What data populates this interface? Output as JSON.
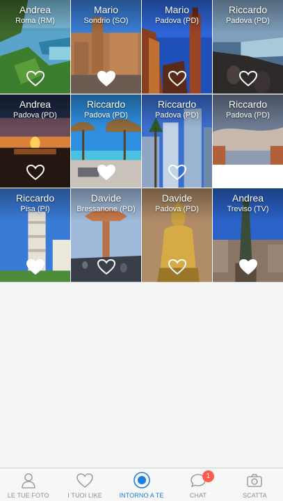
{
  "photos": [
    {
      "user": "Andrea",
      "place": "Roma (RM)",
      "liked": false
    },
    {
      "user": "Mario",
      "place": "Sondrio (SO)",
      "liked": false
    },
    {
      "user": "Mario",
      "place": "Padova (PD)",
      "liked": false
    },
    {
      "user": "Riccardo",
      "place": "Padova (PD)",
      "liked": false
    },
    {
      "user": "Andrea",
      "place": "Padova (PD)",
      "liked": false
    },
    {
      "user": "Riccardo",
      "place": "Padova (PD)",
      "liked": false
    },
    {
      "user": "Riccardo",
      "place": "Padova (PD)",
      "liked": false
    },
    {
      "user": "Riccardo",
      "place": "Padova (PD)",
      "liked": false
    },
    {
      "user": "Riccardo",
      "place": "Pisa (PI)",
      "liked": false
    },
    {
      "user": "Davide",
      "place": "Bressanone (PD)",
      "liked": false
    },
    {
      "user": "Davide",
      "place": "Padova (PD)",
      "liked": false
    },
    {
      "user": "Andrea",
      "place": "Treviso (TV)",
      "liked": false
    }
  ],
  "tabbar": {
    "tabs": [
      {
        "label": "LE TUE FOTO",
        "icon": "person-icon",
        "active": false
      },
      {
        "label": "I TUOI LIKE",
        "icon": "heart-icon",
        "active": false
      },
      {
        "label": "INTORNO A TE",
        "icon": "location-icon",
        "active": true
      },
      {
        "label": "CHAT",
        "icon": "chat-icon",
        "active": false,
        "badge": "1"
      },
      {
        "label": "SCATTA",
        "icon": "camera-icon",
        "active": false
      }
    ]
  },
  "colors": {
    "active": "#1a7de6",
    "inactive": "#8e8e93",
    "badge": "#ff5a4e"
  }
}
